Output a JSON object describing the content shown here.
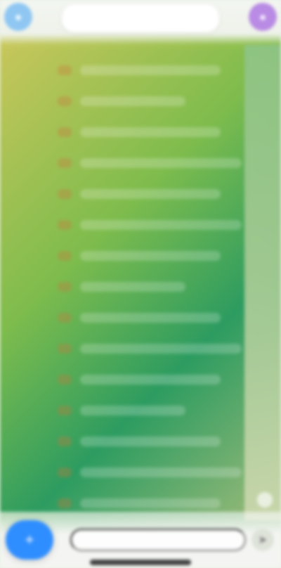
{
  "app": {
    "title": ""
  },
  "header": {
    "left_icon": "avatar-icon",
    "right_icon": "avatar-icon"
  },
  "colors": {
    "accent_blue": "#2f8eff",
    "avatar_blue": "#8fc7f2",
    "avatar_purple": "#b98be4",
    "panel_green": "#3ea15a",
    "panel_yellow": "#d3ca60"
  },
  "list": {
    "rows": [
      {
        "label": ""
      },
      {
        "label": ""
      },
      {
        "label": ""
      },
      {
        "label": ""
      },
      {
        "label": ""
      },
      {
        "label": ""
      },
      {
        "label": ""
      },
      {
        "label": ""
      },
      {
        "label": ""
      },
      {
        "label": ""
      },
      {
        "label": ""
      },
      {
        "label": ""
      },
      {
        "label": ""
      },
      {
        "label": ""
      },
      {
        "label": ""
      }
    ]
  },
  "composer": {
    "placeholder": ""
  },
  "buttons": {
    "fab_icon": "plus-icon",
    "send_icon": "send-icon"
  }
}
